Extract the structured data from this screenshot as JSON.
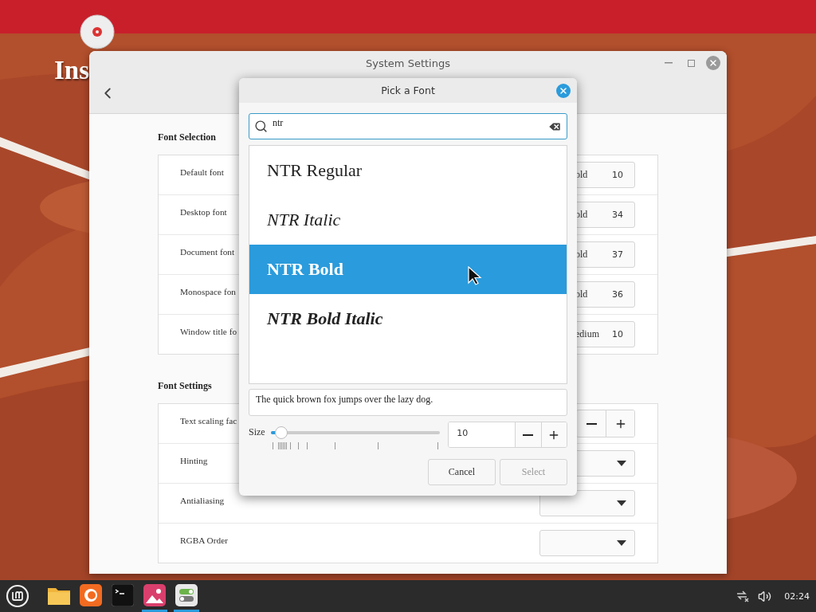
{
  "desktop": {
    "icons": [
      {
        "label": "Ins"
      }
    ]
  },
  "settings_window": {
    "title": "System Settings",
    "sections": [
      {
        "title": "Font Selection",
        "rows": [
          {
            "kind": "font",
            "label": "Default font",
            "font": "old",
            "size": "10"
          },
          {
            "kind": "font",
            "label": "Desktop font",
            "font": "old",
            "size": "34"
          },
          {
            "kind": "font",
            "label": "Document font",
            "font": "old",
            "size": "37"
          },
          {
            "kind": "font",
            "label": "Monospace fon",
            "font": "old",
            "size": "36"
          },
          {
            "kind": "font",
            "label": "Window title fo",
            "font": "edium",
            "size": "10"
          }
        ]
      },
      {
        "title": "Font Settings",
        "rows": [
          {
            "kind": "spin",
            "label": "Text scaling fac"
          },
          {
            "kind": "dropdown",
            "label": "Hinting"
          },
          {
            "kind": "dropdown",
            "label": "Antialiasing"
          },
          {
            "kind": "dropdown",
            "label": "RGBA Order"
          }
        ]
      }
    ]
  },
  "font_dialog": {
    "title": "Pick a Font",
    "search": {
      "value": "ntr"
    },
    "fonts": [
      {
        "name": "NTR Regular",
        "kind": "regular",
        "selected": false
      },
      {
        "name": "NTR Italic",
        "kind": "italic",
        "selected": false
      },
      {
        "name": "NTR Bold",
        "kind": "bold",
        "selected": true
      },
      {
        "name": "NTR Bold Italic",
        "kind": "bolditalic",
        "selected": false
      }
    ],
    "preview": "The quick brown fox jumps over the lazy dog.",
    "size": {
      "label": "Size",
      "level": 0.06,
      "value": "10"
    },
    "buttons": [
      {
        "label": "Cancel",
        "disabled": false
      },
      {
        "label": "Select",
        "disabled": true
      }
    ]
  },
  "taskbar": {
    "apps": [
      {
        "kind": "folder",
        "active": false
      },
      {
        "kind": "browser",
        "active": false
      },
      {
        "kind": "terminal",
        "active": false
      },
      {
        "kind": "image-viewer",
        "active": true
      },
      {
        "kind": "settings",
        "active": true
      }
    ],
    "clock": "02:24"
  }
}
